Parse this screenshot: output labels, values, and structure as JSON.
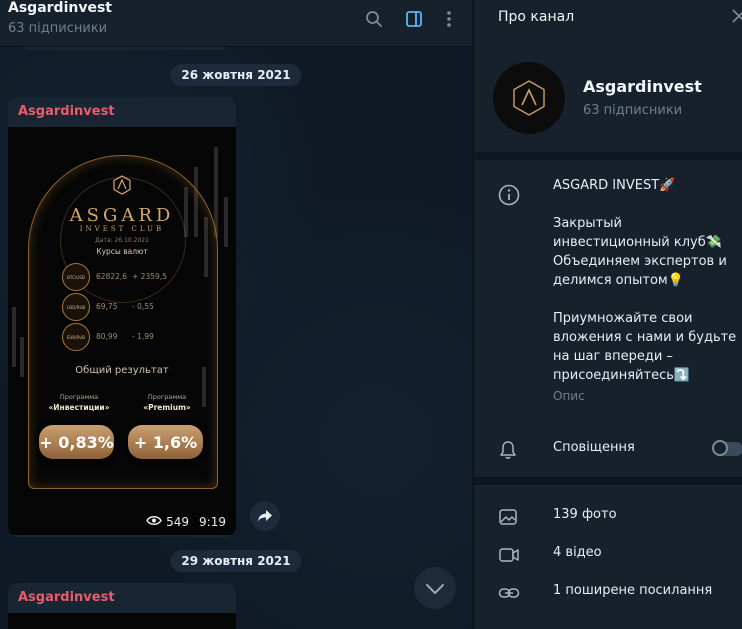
{
  "header": {
    "title": "Asgardinvest",
    "subscribers": "63 підписники"
  },
  "chat": {
    "dates": [
      "26 жовтня 2021",
      "29 жовтня 2021"
    ],
    "messages": [
      {
        "author": "Asgardinvest",
        "views": "549",
        "time": "9:19",
        "image": {
          "brand": "ASGARD",
          "club": "INVEST CLUB",
          "date_line": "Дата: 26.10.2021",
          "rates_title": "Курсы валют",
          "rates": [
            {
              "pair": "BTC/USD",
              "value": "62822,6",
              "change": "+ 2359,5"
            },
            {
              "pair": "USD/RUB",
              "value": "69,75",
              "change": "- 0,55"
            },
            {
              "pair": "EUR/RUB",
              "value": "80,99",
              "change": "- 1,99"
            }
          ],
          "result_title": "Общий результат",
          "programs": [
            {
              "label": "Программа",
              "name": "«Инвестиции»",
              "result": "+ 0,83%"
            },
            {
              "label": "Программа",
              "name": "«Premium»",
              "result": "+ 1,6%"
            }
          ]
        }
      },
      {
        "author": "Asgardinvest"
      }
    ]
  },
  "panel": {
    "title": "Про канал",
    "channel_name": "Asgardinvest",
    "subscribers": "63 підписники",
    "description": {
      "p1": "ASGARD INVEST🚀",
      "p2": "Закрытый инвестиционный клуб💸 Объединяем экспертов и делимся опытом💡",
      "p3": "Приумножайте свои вложения с нами и будьте на шаг впереди – присоединяйтесь⤵️",
      "label": "Опис"
    },
    "notifications_label": "Сповіщення",
    "notifications_on": false,
    "media": [
      {
        "icon": "photo-icon",
        "label": "139 фото"
      },
      {
        "icon": "video-icon",
        "label": "4 відео"
      },
      {
        "icon": "link-icon",
        "label": "1 поширене посилання"
      }
    ]
  },
  "colors": {
    "accent": "#5eb5f7",
    "author": "#e85d69",
    "gold": "#d4a76a"
  }
}
